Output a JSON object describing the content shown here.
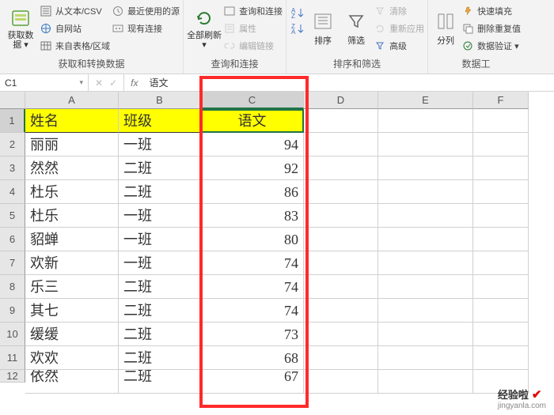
{
  "ribbon": {
    "group1": {
      "big": "获取数\n据 ▾",
      "items": [
        "从文本/CSV",
        "自网站",
        "来自表格/区域",
        "最近使用的源",
        "现有连接"
      ],
      "label": "获取和转换数据"
    },
    "group2": {
      "big": "全部刷新\n▾",
      "items": [
        "查询和连接",
        "属性",
        "编辑链接"
      ],
      "label": "查询和连接"
    },
    "group3": {
      "sort": "排序",
      "filter": "筛选",
      "items": [
        "清除",
        "重新应用",
        "高级"
      ],
      "label": "排序和筛选"
    },
    "group4": {
      "big": "分列",
      "items": [
        "快速填充",
        "删除重复值",
        "数据验证 ▾"
      ],
      "label": "数据工"
    }
  },
  "nameBox": "C1",
  "fxValue": "语文",
  "columns": [
    "A",
    "B",
    "C",
    "D",
    "E",
    "F"
  ],
  "headers": {
    "a": "姓名",
    "b": "班级",
    "c": "语文"
  },
  "rows": [
    {
      "n": 1
    },
    {
      "n": 2,
      "a": "丽丽",
      "b": "一班",
      "c": 94
    },
    {
      "n": 3,
      "a": "然然",
      "b": "二班",
      "c": 92
    },
    {
      "n": 4,
      "a": "杜乐",
      "b": "二班",
      "c": 86
    },
    {
      "n": 5,
      "a": "杜乐",
      "b": "一班",
      "c": 83
    },
    {
      "n": 6,
      "a": "貂蝉",
      "b": "一班",
      "c": 80
    },
    {
      "n": 7,
      "a": "欢新",
      "b": "一班",
      "c": 74
    },
    {
      "n": 8,
      "a": "乐三",
      "b": "二班",
      "c": 74
    },
    {
      "n": 9,
      "a": "其七",
      "b": "二班",
      "c": 74
    },
    {
      "n": 10,
      "a": "缓缓",
      "b": "二班",
      "c": 73
    },
    {
      "n": 11,
      "a": "欢欢",
      "b": "二班",
      "c": 68
    },
    {
      "n": 12,
      "a": "依然",
      "b": "二班",
      "c": 67
    }
  ],
  "chart_data": {
    "type": "table",
    "title": "",
    "columns": [
      "姓名",
      "班级",
      "语文"
    ],
    "rows": [
      [
        "丽丽",
        "一班",
        94
      ],
      [
        "然然",
        "二班",
        92
      ],
      [
        "杜乐",
        "二班",
        86
      ],
      [
        "杜乐",
        "一班",
        83
      ],
      [
        "貂蝉",
        "一班",
        80
      ],
      [
        "欢新",
        "一班",
        74
      ],
      [
        "乐三",
        "二班",
        74
      ],
      [
        "其七",
        "二班",
        74
      ],
      [
        "缓缓",
        "二班",
        73
      ],
      [
        "欢欢",
        "二班",
        68
      ],
      [
        "依然",
        "二班",
        67
      ]
    ]
  },
  "watermark": {
    "text": "经验啦",
    "check": "✔",
    "sub": "jingyanla.com"
  }
}
